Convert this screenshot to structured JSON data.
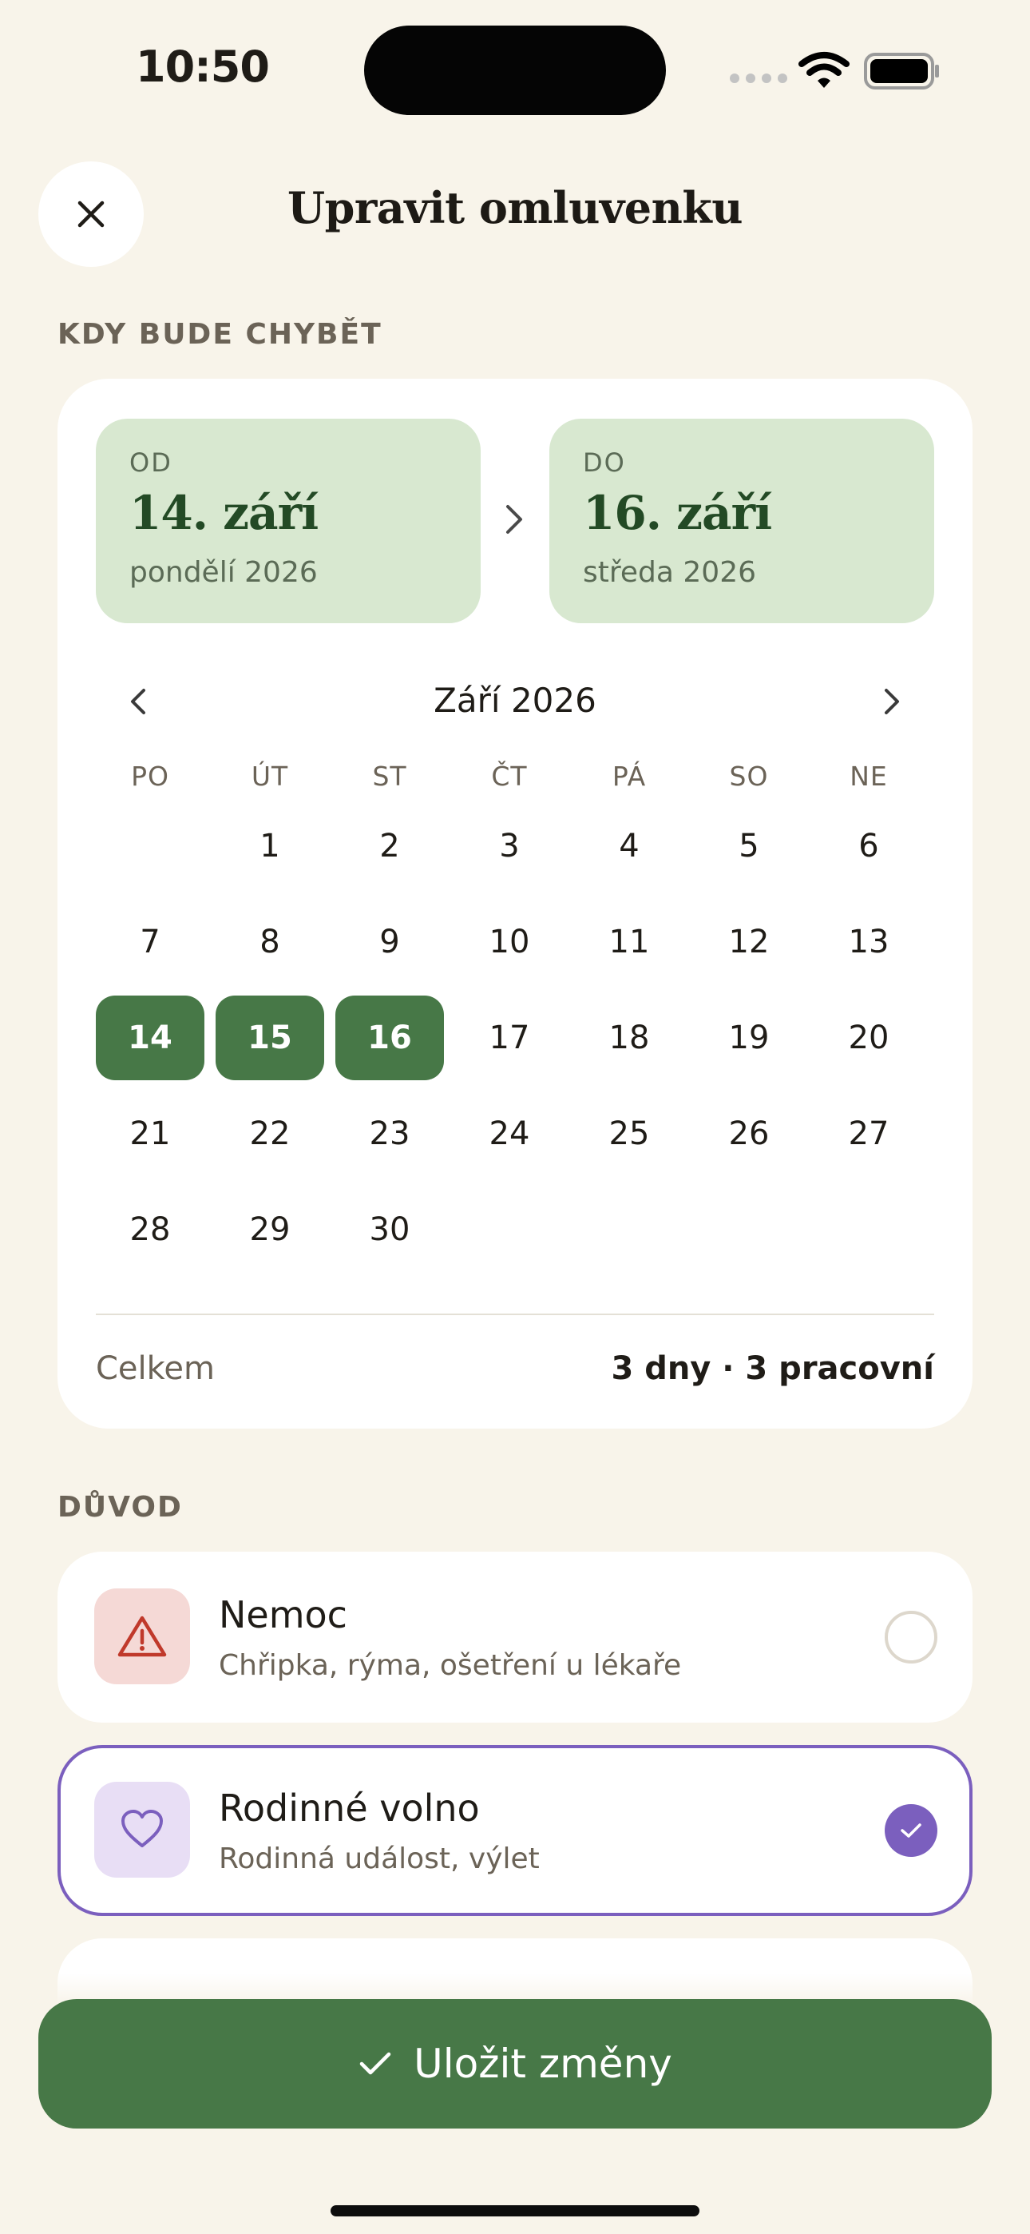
{
  "status_bar": {
    "time": "10:50"
  },
  "header": {
    "title": "Upravit omluvenku",
    "close_icon": "close-icon"
  },
  "when": {
    "section_label": "KDY BUDE CHYBĚT",
    "from": {
      "label": "OD",
      "date": "14. září",
      "weekday_year": "pondělí 2026"
    },
    "to": {
      "label": "DO",
      "date": "16. září",
      "weekday_year": "středa 2026"
    }
  },
  "calendar": {
    "month_title": "Září 2026",
    "weekdays": [
      "PO",
      "ÚT",
      "ST",
      "ČT",
      "PÁ",
      "SO",
      "NE"
    ],
    "first_weekday_index": 1,
    "days_in_month": 30,
    "selected_days": [
      14,
      15,
      16
    ]
  },
  "summary": {
    "label": "Celkem",
    "value": "3 dny · 3 pracovní"
  },
  "reason": {
    "section_label": "DŮVOD",
    "options": [
      {
        "name": "Nemoc",
        "description": "Chřipka, rýma, ošetření u lékaře",
        "icon": "warning-icon",
        "selected": false
      },
      {
        "name": "Rodinné volno",
        "description": "Rodinná událost, výlet",
        "icon": "heart-icon",
        "selected": true
      }
    ]
  },
  "save_button": {
    "label": "Uložit změny",
    "icon": "check-icon"
  },
  "colors": {
    "accent_green": "#477847",
    "accent_purple": "#7b5fbe",
    "date_box_bg": "#d8e8d0",
    "warning_red": "#c0392b"
  }
}
